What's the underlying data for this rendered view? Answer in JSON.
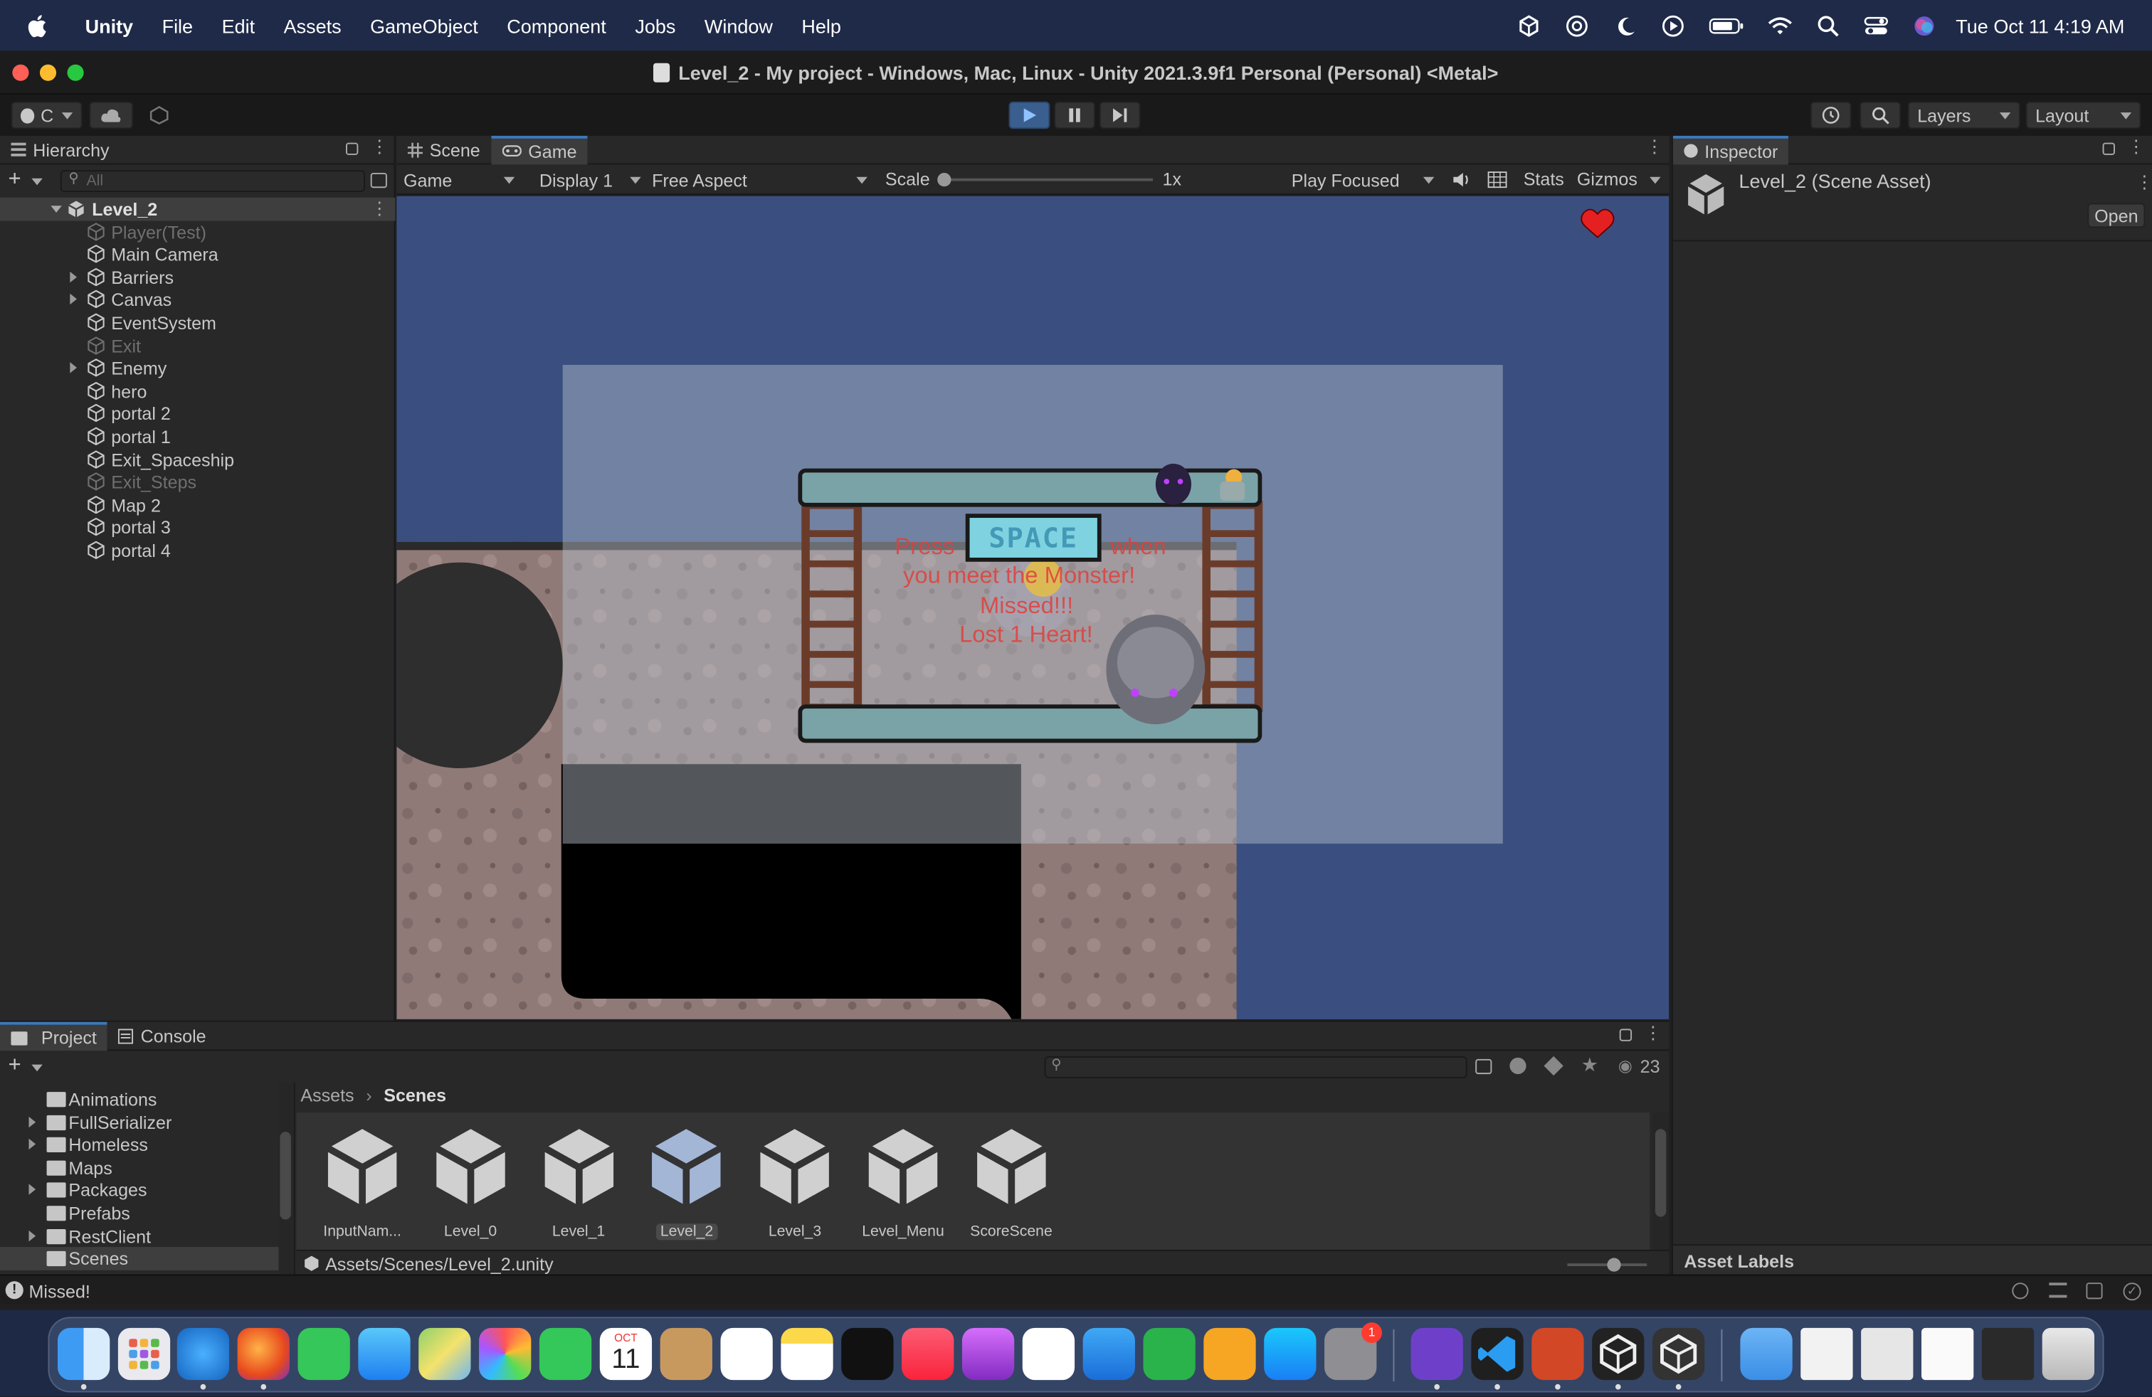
{
  "menubar": {
    "app": "Unity",
    "items": [
      "File",
      "Edit",
      "Assets",
      "GameObject",
      "Component",
      "Jobs",
      "Window",
      "Help"
    ],
    "clock": "Tue Oct 11  4:19 AM"
  },
  "window": {
    "title": "Level_2 - My project - Windows, Mac, Linux - Unity 2021.3.9f1 Personal (Personal) <Metal>"
  },
  "toolbar": {
    "account": "C",
    "layers": "Layers",
    "layout": "Layout"
  },
  "hierarchy": {
    "tab": "Hierarchy",
    "search_placeholder": "All",
    "scene": "Level_2",
    "items": [
      {
        "label": "Player(Test)",
        "dim": true,
        "arrow": false
      },
      {
        "label": "Main Camera",
        "dim": false,
        "arrow": false
      },
      {
        "label": "Barriers",
        "dim": false,
        "arrow": true
      },
      {
        "label": "Canvas",
        "dim": false,
        "arrow": true
      },
      {
        "label": "EventSystem",
        "dim": false,
        "arrow": false
      },
      {
        "label": "Exit",
        "dim": true,
        "arrow": false
      },
      {
        "label": "Enemy",
        "dim": false,
        "arrow": true
      },
      {
        "label": "hero",
        "dim": false,
        "arrow": false
      },
      {
        "label": "portal 2",
        "dim": false,
        "arrow": false
      },
      {
        "label": "portal 1",
        "dim": false,
        "arrow": false
      },
      {
        "label": "Exit_Spaceship",
        "dim": false,
        "arrow": false
      },
      {
        "label": "Exit_Steps",
        "dim": true,
        "arrow": false
      },
      {
        "label": "Map 2",
        "dim": false,
        "arrow": false
      },
      {
        "label": "portal 3",
        "dim": false,
        "arrow": false
      },
      {
        "label": "portal 4",
        "dim": false,
        "arrow": false
      }
    ]
  },
  "game": {
    "tabs": {
      "scene": "Scene",
      "game": "Game"
    },
    "mode": "Game",
    "display": "Display 1",
    "aspect": "Free Aspect",
    "scale_label": "Scale",
    "scale_value": "1x",
    "play_focused": "Play Focused",
    "stats": "Stats",
    "gizmos": "Gizmos",
    "overlay": {
      "press": "Press",
      "key": "SPACE",
      "when": "when",
      "line2": "you meet the Monster!",
      "missed": "Missed!!!",
      "lost": "Lost 1 Heart!"
    }
  },
  "inspector": {
    "tab": "Inspector",
    "asset": "Level_2 (Scene Asset)",
    "open": "Open",
    "labels": "Asset Labels"
  },
  "project": {
    "tabs": {
      "project": "Project",
      "console": "Console"
    },
    "folders": [
      {
        "label": "Animations",
        "arrow": false
      },
      {
        "label": "FullSerializer",
        "arrow": true
      },
      {
        "label": "Homeless",
        "arrow": true
      },
      {
        "label": "Maps",
        "arrow": false
      },
      {
        "label": "Packages",
        "arrow": true
      },
      {
        "label": "Prefabs",
        "arrow": false
      },
      {
        "label": "RestClient",
        "arrow": true
      },
      {
        "label": "Scenes",
        "arrow": false
      }
    ],
    "breadcrumb": {
      "root": "Assets",
      "current": "Scenes"
    },
    "hidden_count": "23",
    "assets": [
      "InputNam...",
      "Level_0",
      "Level_1",
      "Level_2",
      "Level_3",
      "Level_Menu",
      "ScoreScene"
    ],
    "path": "Assets/Scenes/Level_2.unity"
  },
  "status": {
    "message": "Missed!"
  },
  "dock": {
    "calendar_month": "OCT",
    "calendar_day": "11",
    "settings_badge": "1"
  },
  "colors": {
    "accent": "#3a79bb",
    "overlay_text": "#e0403c",
    "sky": "#3a4f80"
  }
}
